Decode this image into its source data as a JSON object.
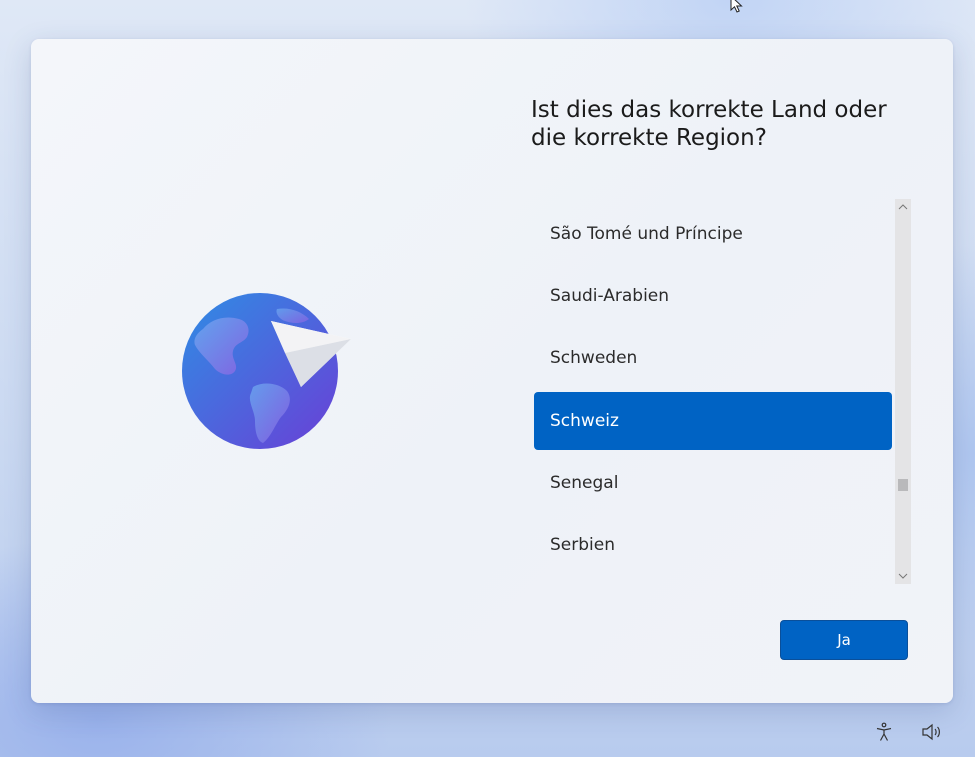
{
  "setup": {
    "title": "Ist dies das korrekte Land oder die korrekte Region?",
    "countries": [
      {
        "label": "São Tomé und Príncipe",
        "selected": false
      },
      {
        "label": "Saudi-Arabien",
        "selected": false
      },
      {
        "label": "Schweden",
        "selected": false
      },
      {
        "label": "Schweiz",
        "selected": true
      },
      {
        "label": "Senegal",
        "selected": false
      },
      {
        "label": "Serbien",
        "selected": false
      }
    ],
    "confirm_label": "Ja"
  },
  "taskbar": {
    "icons": [
      "accessibility-icon",
      "volume-icon"
    ]
  },
  "colors": {
    "accent": "#0063c4",
    "card_background": "#f2f4f8",
    "globe_top": "#2f8de4",
    "globe_bottom": "#6a3fd6"
  }
}
